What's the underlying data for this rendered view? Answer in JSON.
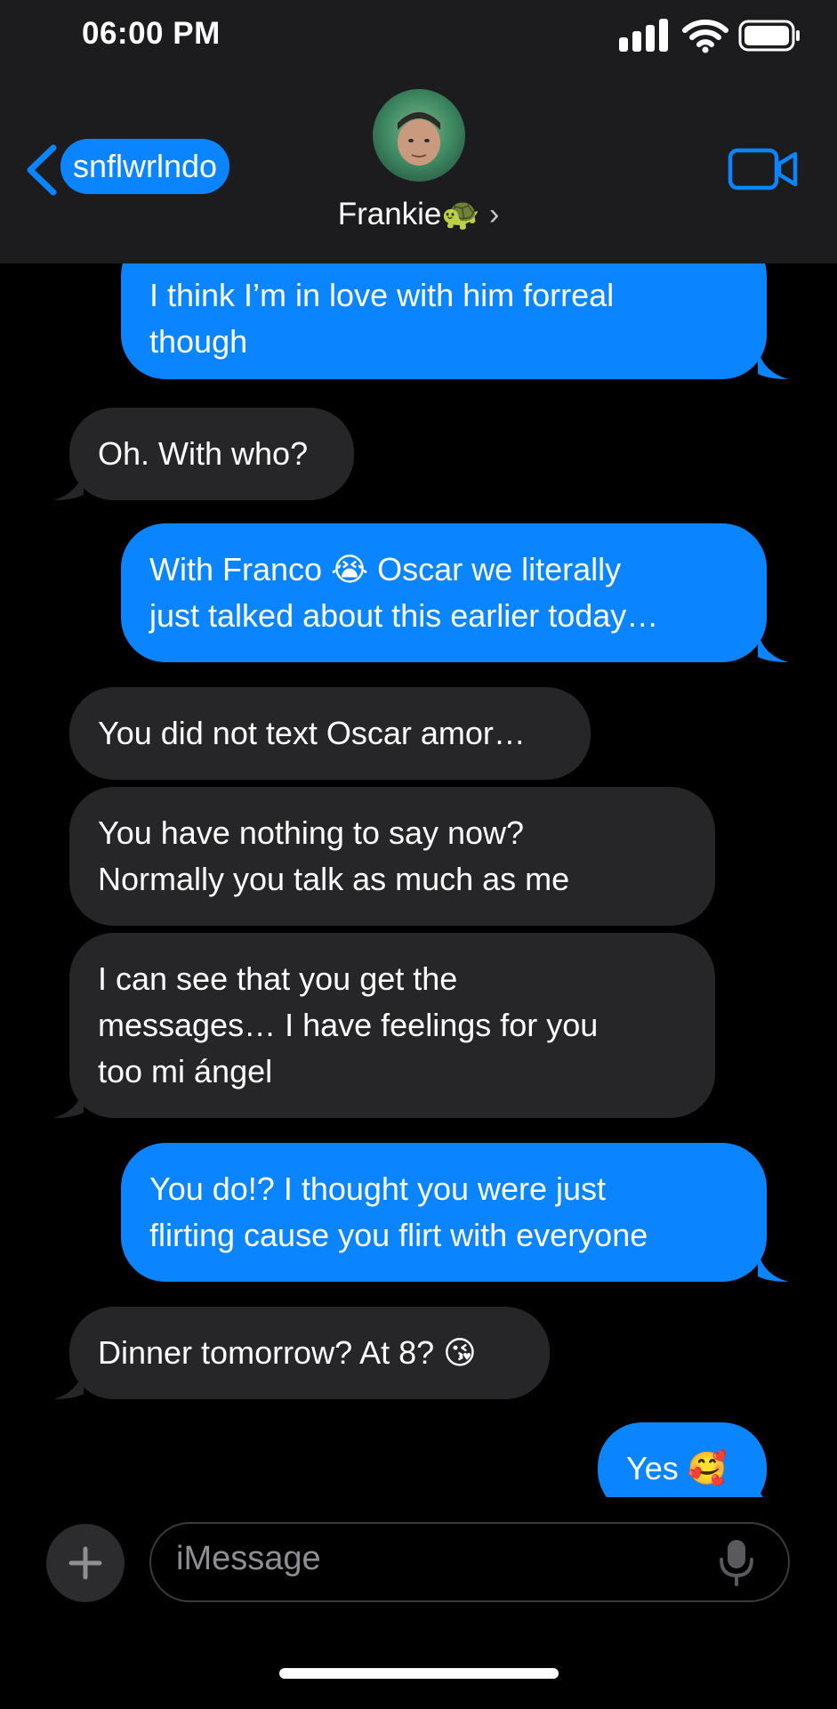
{
  "status_bar": {
    "time": "06:00 PM",
    "icons": [
      "signal-icon",
      "wifi-icon",
      "battery-icon"
    ]
  },
  "header": {
    "back_label": "snflwrlndo",
    "contact_name": "Frankie🐢",
    "chevron": "›",
    "icons": [
      "chevron-left-icon",
      "avatar",
      "chevron-right-icon",
      "video-call-icon"
    ]
  },
  "messages": [
    {
      "direction": "sent",
      "lines": [
        "I think I’m in love with him forreal",
        "though"
      ]
    },
    {
      "direction": "received",
      "lines": [
        "Oh. With who?"
      ]
    },
    {
      "direction": "sent",
      "lines": [
        "With Franco 😭 Oscar we literally",
        "just talked about this earlier today…"
      ]
    },
    {
      "direction": "received",
      "lines": [
        "You did not text Oscar amor…"
      ]
    },
    {
      "direction": "received",
      "lines": [
        "You have nothing to say now?",
        "Normally you talk as much as me"
      ]
    },
    {
      "direction": "received",
      "lines": [
        "I can see that you get the",
        "messages… I have feelings for you",
        "too mi ángel"
      ]
    },
    {
      "direction": "sent",
      "lines": [
        "You do!? I thought you were just",
        "flirting cause you flirt with everyone"
      ]
    },
    {
      "direction": "received",
      "lines": [
        "Dinner tomorrow? At 8? 😘"
      ]
    },
    {
      "direction": "sent",
      "lines": [
        "Yes 🥰"
      ]
    }
  ],
  "input": {
    "placeholder": "iMessage",
    "icons": [
      "plus-icon",
      "microphone-icon"
    ]
  },
  "colors": {
    "background": "#000000",
    "header_background": "#1c1c1e",
    "sent_bubble": "#0a84ff",
    "received_bubble": "#262628",
    "accent": "#0a84ff"
  }
}
